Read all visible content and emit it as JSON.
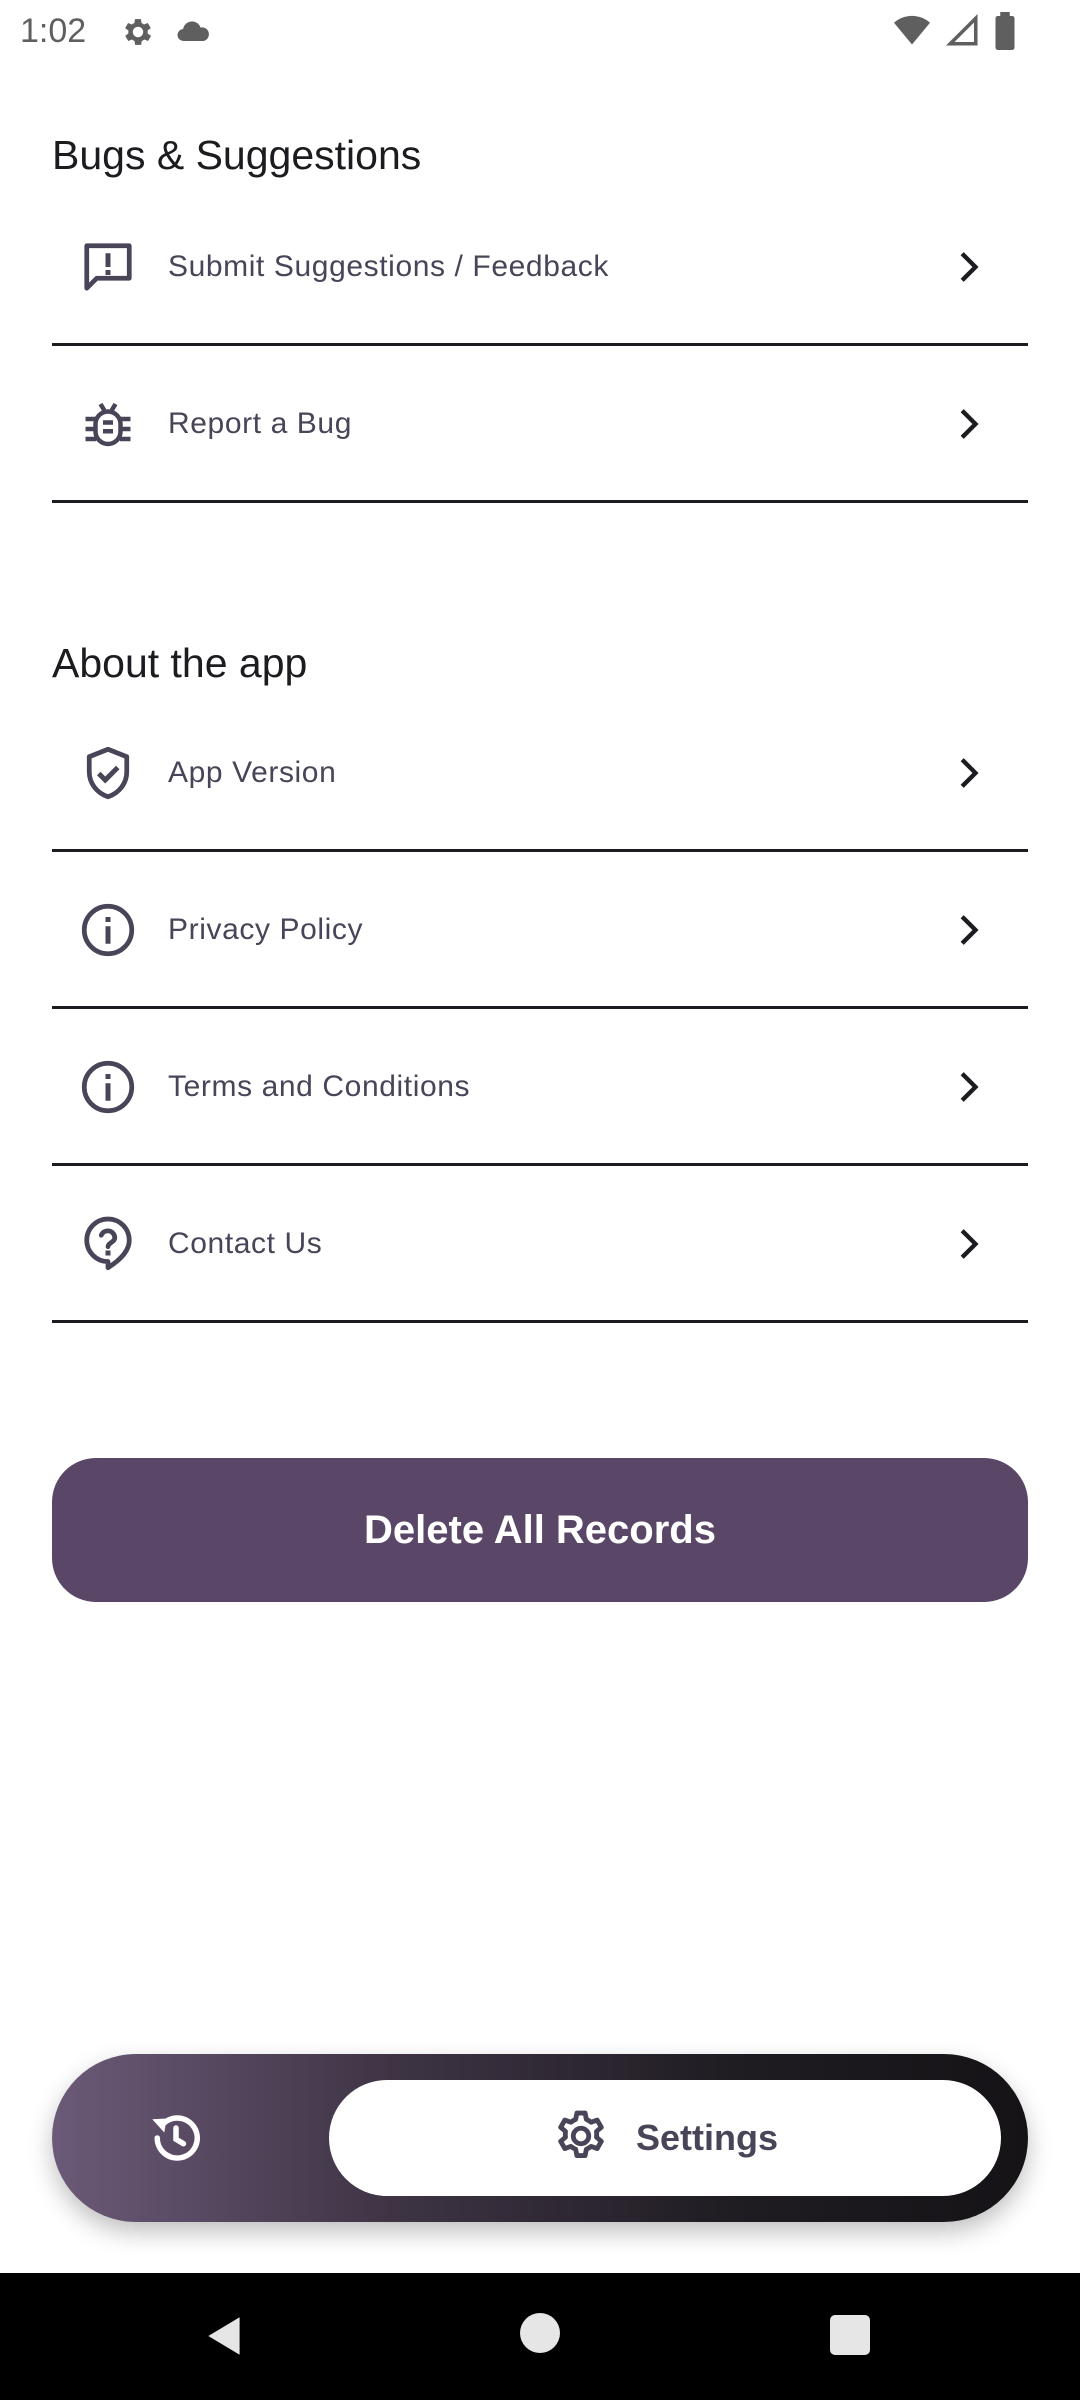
{
  "status_bar": {
    "time": "1:02",
    "left_icons": [
      "gear-icon",
      "cloud-icon"
    ],
    "right_icons": [
      "wifi-icon",
      "signal-icon",
      "battery-icon"
    ]
  },
  "sections": [
    {
      "title": "Bugs & Suggestions",
      "items": [
        {
          "label": "Submit Suggestions / Feedback",
          "icon": "feedback-icon"
        },
        {
          "label": "Report a Bug",
          "icon": "bug-icon"
        }
      ]
    },
    {
      "title": "About the app",
      "items": [
        {
          "label": "App Version",
          "icon": "verified-shield-icon"
        },
        {
          "label": "Privacy Policy",
          "icon": "info-icon"
        },
        {
          "label": "Terms and Conditions",
          "icon": "info-icon"
        },
        {
          "label": "Contact Us",
          "icon": "help-icon"
        }
      ]
    }
  ],
  "delete_button": {
    "label": "Delete All Records"
  },
  "bottom_nav": {
    "items": [
      {
        "icon": "history-icon",
        "label": ""
      },
      {
        "icon": "settings-icon",
        "label": "Settings",
        "active": true
      }
    ]
  },
  "colors": {
    "accent": "#5a4768",
    "row_text": "#4a4458",
    "divider": "#1c1b1f"
  }
}
